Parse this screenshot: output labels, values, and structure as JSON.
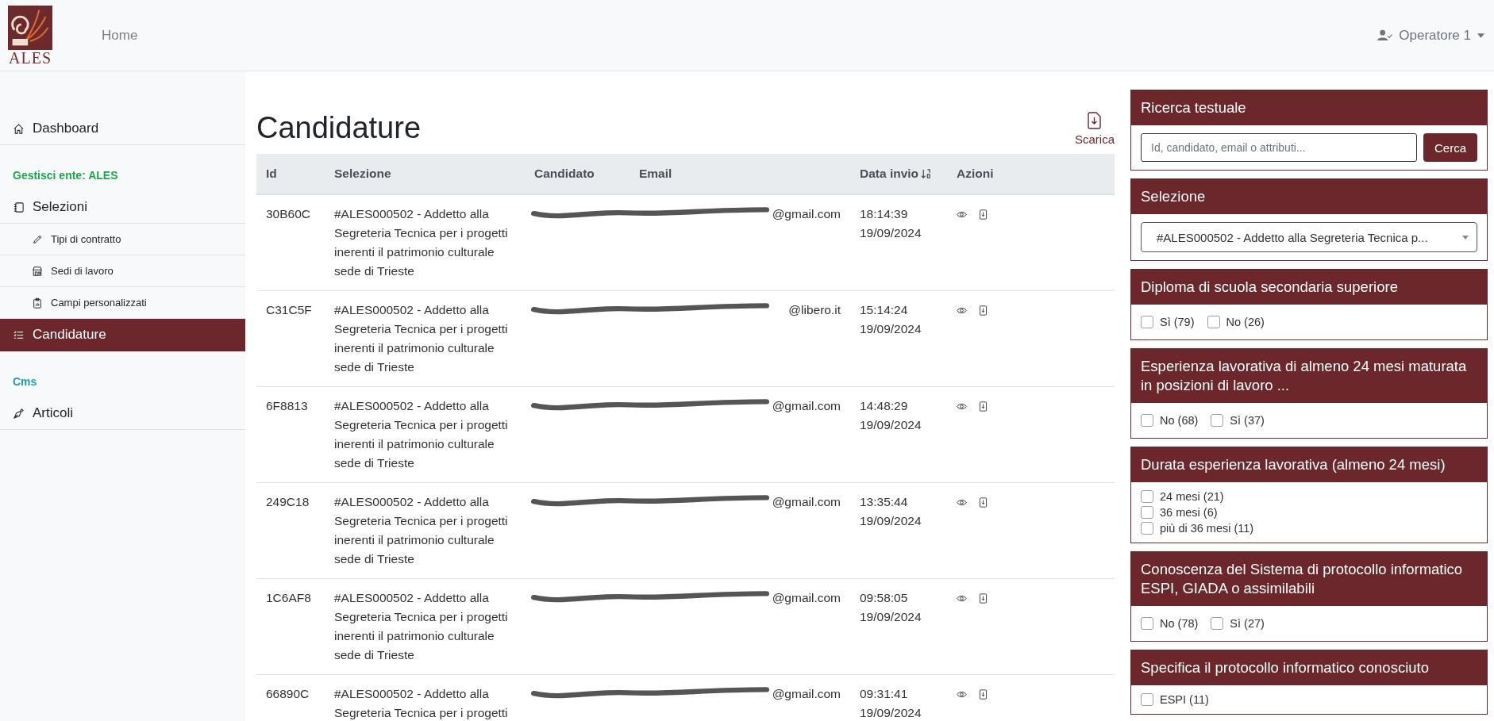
{
  "header": {
    "logo_text": "ALES",
    "nav": [
      {
        "label": "Home"
      }
    ],
    "user": "Operatore 1"
  },
  "sidebar": {
    "items": [
      {
        "kind": "item",
        "label": "Dashboard",
        "selected": false
      },
      {
        "kind": "section",
        "label": "Gestisci ente: ALES",
        "color": "#1fa64a"
      },
      {
        "kind": "item",
        "label": "Selezioni",
        "selected": false
      },
      {
        "kind": "subitem",
        "label": "Tipi di contratto",
        "selected": false
      },
      {
        "kind": "subitem",
        "label": "Sedi di lavoro",
        "selected": false
      },
      {
        "kind": "subitem",
        "label": "Campi personalizzati",
        "selected": false
      },
      {
        "kind": "item",
        "label": "Candidature",
        "selected": true
      },
      {
        "kind": "section",
        "label": "Cms",
        "color": "#1d9bb5"
      },
      {
        "kind": "item",
        "label": "Articoli",
        "selected": false
      }
    ]
  },
  "page": {
    "title": "Candidature",
    "download": "Scarica"
  },
  "table": {
    "columns": [
      {
        "label": "Id",
        "sorted": false
      },
      {
        "label": "Selezione",
        "sorted": false
      },
      {
        "label": "Candidato",
        "sorted": false
      },
      {
        "label": "Email",
        "sorted": false
      },
      {
        "label": "Data invio",
        "sorted": true
      },
      {
        "label": "Azioni",
        "sorted": false
      }
    ],
    "rows": [
      {
        "id": "30B60C",
        "selezione": "#ALES000502 - Addetto alla Segreteria Tecnica per i progetti inerenti il patrimonio culturale sede di Trieste",
        "redacted": true,
        "email": "@gmail.com",
        "time": "18:14:39",
        "date": "19/09/2024"
      },
      {
        "id": "C31C5F",
        "selezione": "#ALES000502 - Addetto alla Segreteria Tecnica per i progetti inerenti il patrimonio culturale sede di Trieste",
        "redacted": true,
        "email": "@libero.it",
        "time": "15:14:24",
        "date": "19/09/2024"
      },
      {
        "id": "6F8813",
        "selezione": "#ALES000502 - Addetto alla Segreteria Tecnica per i progetti inerenti il patrimonio culturale sede di Trieste",
        "redacted": true,
        "email": "@gmail.com",
        "time": "14:48:29",
        "date": "19/09/2024"
      },
      {
        "id": "249C18",
        "selezione": "#ALES000502 - Addetto alla Segreteria Tecnica per i progetti inerenti il patrimonio culturale sede di Trieste",
        "redacted": true,
        "email": "@gmail.com",
        "time": "13:35:44",
        "date": "19/09/2024"
      },
      {
        "id": "1C6AF8",
        "selezione": "#ALES000502 - Addetto alla Segreteria Tecnica per i progetti inerenti il patrimonio culturale sede di Trieste",
        "redacted": true,
        "email": "@gmail.com",
        "time": "09:58:05",
        "date": "19/09/2024"
      },
      {
        "id": "66890C",
        "selezione": "#ALES000502 - Addetto alla Segreteria Tecnica per i progetti",
        "redacted": true,
        "email": "@gmail.com",
        "time": "09:31:41",
        "date": "19/09/2024"
      }
    ]
  },
  "filters": [
    {
      "kind": "search",
      "title": "Ricerca testuale",
      "placeholder": "Id, candidato, email o attributi...",
      "button": "Cerca"
    },
    {
      "kind": "select",
      "title": "Selezione",
      "value": "#ALES000502 - Addetto alla Segreteria Tecnica p..."
    },
    {
      "kind": "inline",
      "title": "Diploma di scuola secondaria superiore",
      "options": [
        {
          "label": "Sì (79)",
          "checked": false
        },
        {
          "label": "No (26)",
          "checked": false
        }
      ]
    },
    {
      "kind": "inline",
      "title": "Esperienza lavorativa di almeno 24 mesi maturata in posizioni di lavoro ...",
      "options": [
        {
          "label": "No (68)",
          "checked": false
        },
        {
          "label": "Sì (37)",
          "checked": false
        }
      ]
    },
    {
      "kind": "stacked",
      "title": "Durata esperienza lavorativa (almeno 24 mesi)",
      "options": [
        {
          "label": "24 mesi (21)",
          "checked": false
        },
        {
          "label": "36 mesi (6)",
          "checked": false
        },
        {
          "label": "più di 36 mesi (11)",
          "checked": false
        }
      ]
    },
    {
      "kind": "inline",
      "title": "Conoscenza del Sistema di protocollo informatico ESPI, GIADA o assimilabili",
      "options": [
        {
          "label": "No (78)",
          "checked": false
        },
        {
          "label": "Sì (27)",
          "checked": false
        }
      ]
    },
    {
      "kind": "stacked",
      "title": "Specifica il protocollo informatico conosciuto",
      "options": [
        {
          "label": "ESPI (11)",
          "checked": false
        }
      ]
    }
  ]
}
